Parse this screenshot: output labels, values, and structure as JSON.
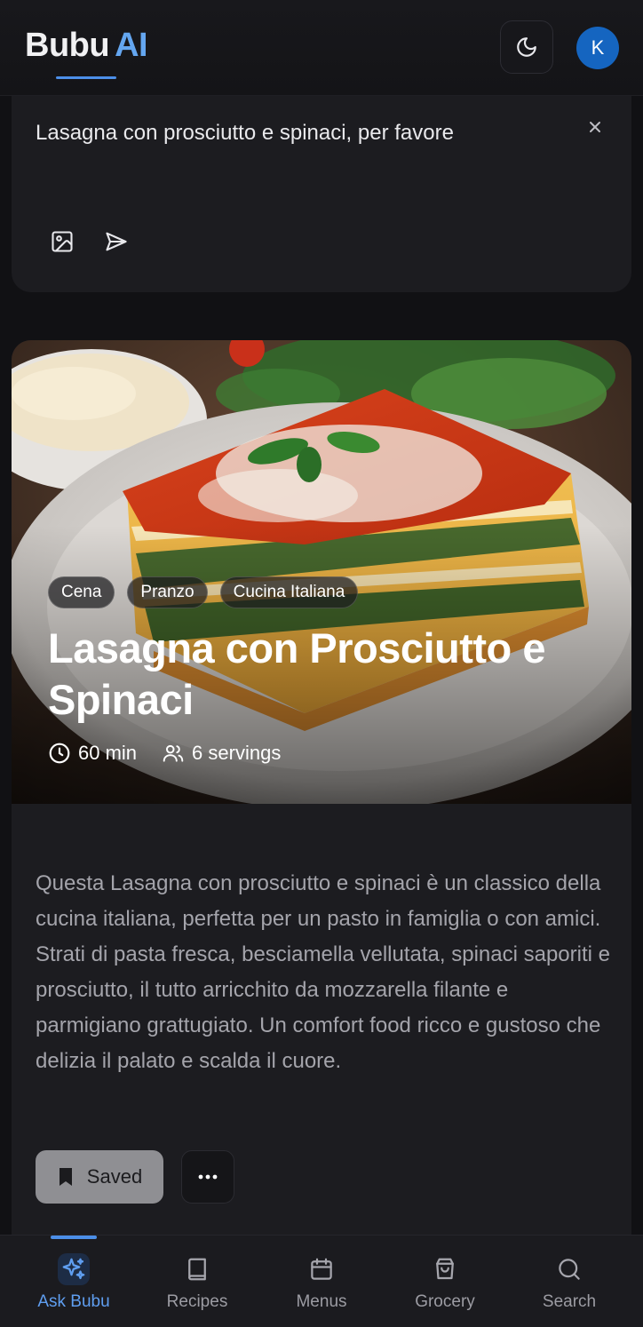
{
  "header": {
    "brand_main": "Bubu",
    "brand_accent": "AI",
    "theme_icon": "moon-icon",
    "avatar_initial": "K",
    "avatar_color": "#1565c0",
    "accent_color": "#4c8fe8"
  },
  "prompt": {
    "text": "Lasagna con prosciutto e spinaci, per favore",
    "clear_icon": "close-icon",
    "image_icon": "image-icon",
    "send_icon": "send-icon"
  },
  "recipe": {
    "tags": [
      "Cena",
      "Pranzo",
      "Cucina Italiana"
    ],
    "title": "Lasagna con Prosciutto e Spinaci",
    "time": "60 min",
    "servings": "6 servings",
    "description": "Questa Lasagna con prosciutto e spinaci è un classico della cucina italiana, perfetta per un pasto in famiglia o con amici. Strati di pasta fresca, besciamella vellutata, spinaci saporiti e prosciutto, il tutto arricchito da mozzarella filante e parmigiano grattugiato. Un comfort food ricco e gustoso che delizia il palato e scalda il cuore.",
    "saved_label": "Saved",
    "more_icon": "more-icon"
  },
  "nav": {
    "items": [
      {
        "label": "Ask Bubu",
        "icon": "sparkles-icon",
        "active": true
      },
      {
        "label": "Recipes",
        "icon": "book-icon",
        "active": false
      },
      {
        "label": "Menus",
        "icon": "calendar-icon",
        "active": false
      },
      {
        "label": "Grocery",
        "icon": "shopping-bag-icon",
        "active": false
      },
      {
        "label": "Search",
        "icon": "search-icon",
        "active": false
      }
    ]
  }
}
